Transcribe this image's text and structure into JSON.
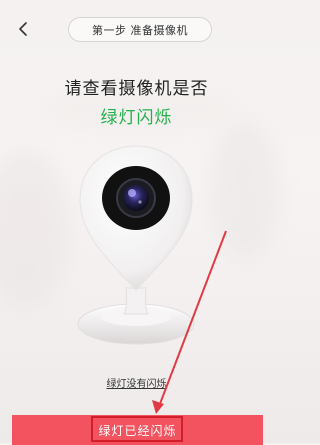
{
  "header": {
    "step_title": "第一步 准备摄像机"
  },
  "main": {
    "heading": "请查看摄像机是否",
    "subheading": "绿灯闪烁",
    "link_no_blink": "绿灯没有闪烁",
    "confirm_button": "绿灯已经闪烁"
  },
  "colors": {
    "accent": "#f2535f",
    "green_text": "#22b14c",
    "annotation": "#e03b45"
  },
  "icons": {
    "back": "back-chevron-icon"
  }
}
